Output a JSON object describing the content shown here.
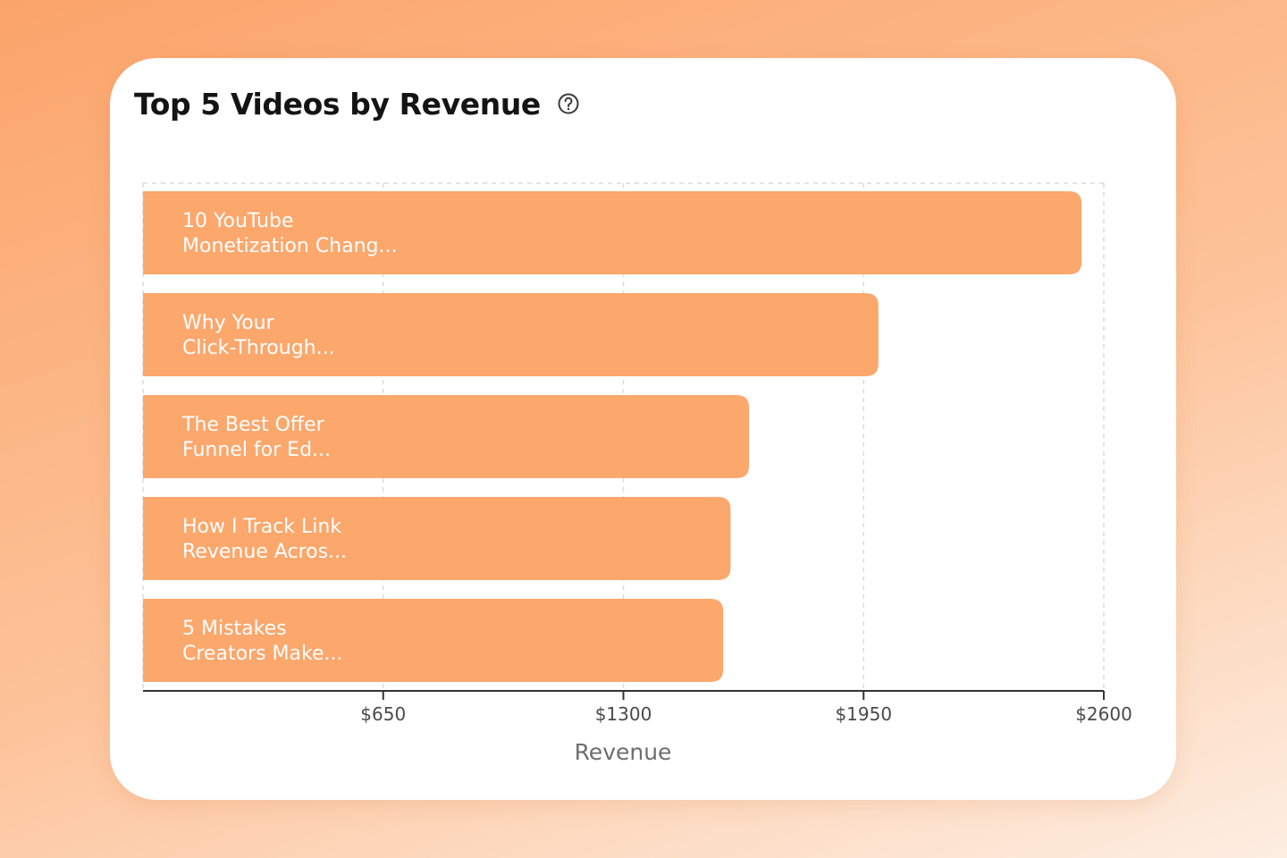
{
  "card": {
    "title": "Top 5 Videos by Revenue",
    "help_icon": "question-circle-icon"
  },
  "chart_data": {
    "type": "bar",
    "orientation": "horizontal",
    "title": "Top 5 Videos by Revenue",
    "categories": [
      [
        "10 YouTube",
        "Monetization Chang..."
      ],
      [
        "Why Your",
        "Click-Through..."
      ],
      [
        "The Best Offer",
        "Funnel for Ed..."
      ],
      [
        "How I Track Link",
        "Revenue Acros..."
      ],
      [
        "5 Mistakes",
        "Creators Make..."
      ]
    ],
    "values": [
      2540,
      1990,
      1640,
      1590,
      1570
    ],
    "xlabel": "Revenue",
    "ylabel": "",
    "xlim": [
      0,
      2600
    ],
    "xticks": [
      650,
      1300,
      1950,
      2600
    ],
    "xtick_labels": [
      "$650",
      "$1300",
      "$1950",
      "$2600"
    ],
    "grid": "vertical-dashed",
    "bar_color": "#fca76c",
    "label_position": "inside-bar"
  }
}
